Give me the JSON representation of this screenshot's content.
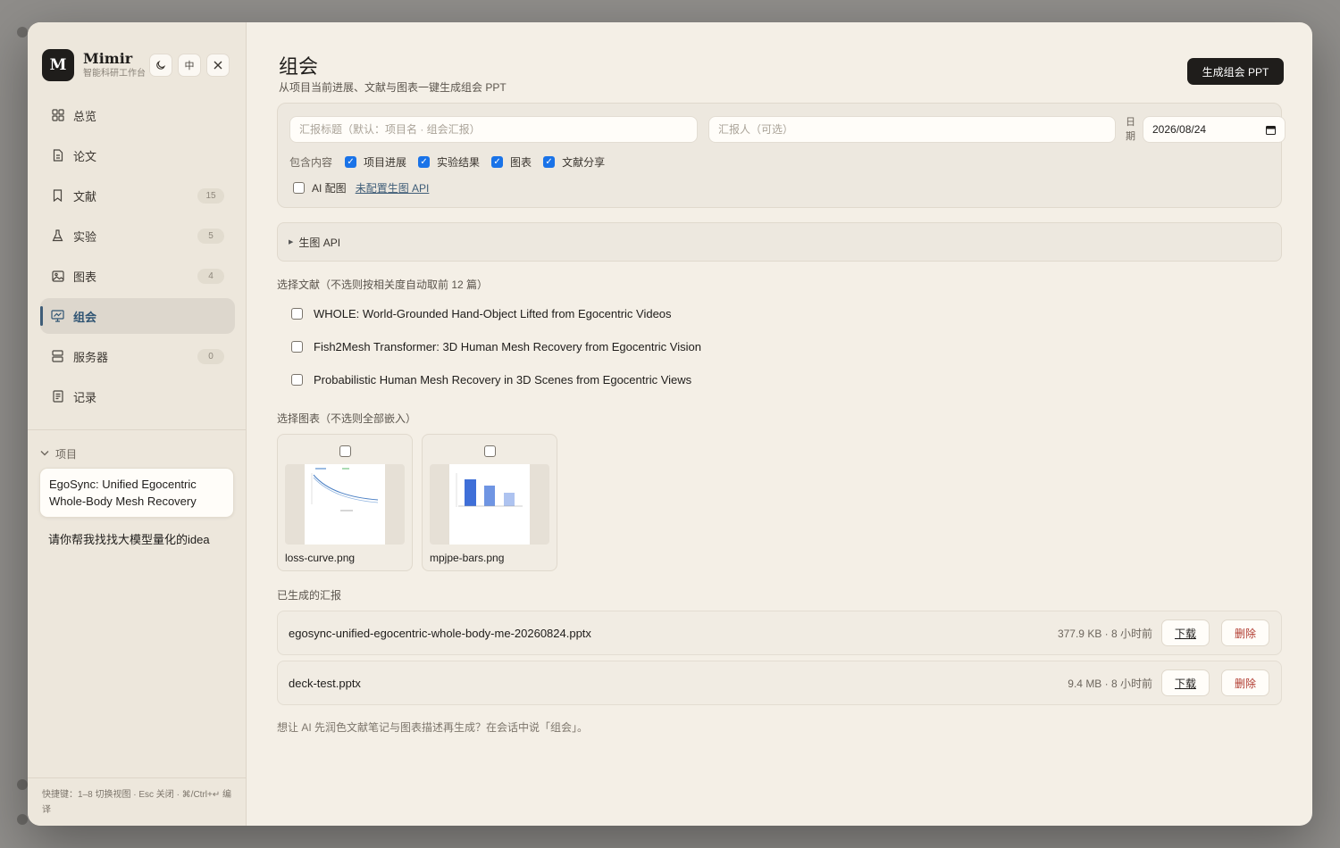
{
  "app": {
    "name": "Mimir",
    "subtitle": "智能科研工作台",
    "logo_letter": "M"
  },
  "header_buttons": {
    "theme_icon": "moon-icon",
    "lang_label": "中",
    "close_icon": "close-icon"
  },
  "sidebar": {
    "items": [
      {
        "label": "总览",
        "icon": "grid-icon",
        "count": null,
        "active": false
      },
      {
        "label": "论文",
        "icon": "document-icon",
        "count": null,
        "active": false
      },
      {
        "label": "文献",
        "icon": "bookmark-icon",
        "count": "15",
        "active": false
      },
      {
        "label": "实验",
        "icon": "flask-icon",
        "count": "5",
        "active": false
      },
      {
        "label": "图表",
        "icon": "image-icon",
        "count": "4",
        "active": false
      },
      {
        "label": "组会",
        "icon": "presentation-icon",
        "count": null,
        "active": true
      },
      {
        "label": "服务器",
        "icon": "server-icon",
        "count": "0",
        "active": false
      },
      {
        "label": "记录",
        "icon": "notes-icon",
        "count": null,
        "active": false
      }
    ],
    "projects_header": "项目",
    "projects": [
      "EgoSync: Unified Egocentric Whole-Body Mesh Recovery",
      "请你帮我找找大模型量化的idea"
    ],
    "footer": "快捷键：1–8 切换视图 · Esc 关闭 · ⌘/Ctrl+↵ 编译"
  },
  "main": {
    "title": "组会",
    "subtitle": "从项目当前进展、文献与图表一键生成组会 PPT",
    "generate_button": "生成组会 PPT",
    "form": {
      "title_placeholder": "汇报标题（默认：项目名 · 组会汇报）",
      "reporter_placeholder": "汇报人（可选）",
      "date_label": "日期",
      "date_value": "2026/08/24",
      "include_label": "包含内容",
      "include_options": [
        {
          "label": "项目进展",
          "checked": true
        },
        {
          "label": "实验结果",
          "checked": true
        },
        {
          "label": "图表",
          "checked": true
        },
        {
          "label": "文献分享",
          "checked": true
        }
      ],
      "ai_label": "AI 配图",
      "ai_checked": false,
      "ai_link": "未配置生图 API"
    },
    "api_section": "生图 API",
    "literature_label": "选择文献（不选则按相关度自动取前 12 篇）",
    "literature": [
      "WHOLE: World-Grounded Hand-Object Lifted from Egocentric Videos",
      "Fish2Mesh Transformer: 3D Human Mesh Recovery from Egocentric Vision",
      "Probabilistic Human Mesh Recovery in 3D Scenes from Egocentric Views"
    ],
    "figures_label": "选择图表（不选则全部嵌入）",
    "figures": [
      {
        "name": "loss-curve.png"
      },
      {
        "name": "mpjpe-bars.png"
      }
    ],
    "reports_label": "已生成的汇报",
    "reports": [
      {
        "name": "egosync-unified-egocentric-whole-body-me-20260824.pptx",
        "meta": "377.9 KB · 8 小时前"
      },
      {
        "name": "deck-test.pptx",
        "meta": "9.4 MB · 8 小时前"
      }
    ],
    "download_label": "下载",
    "delete_label": "删除",
    "hint": "想让 AI 先润色文献笔记与图表描述再生成？在会话中说「组会」。"
  }
}
